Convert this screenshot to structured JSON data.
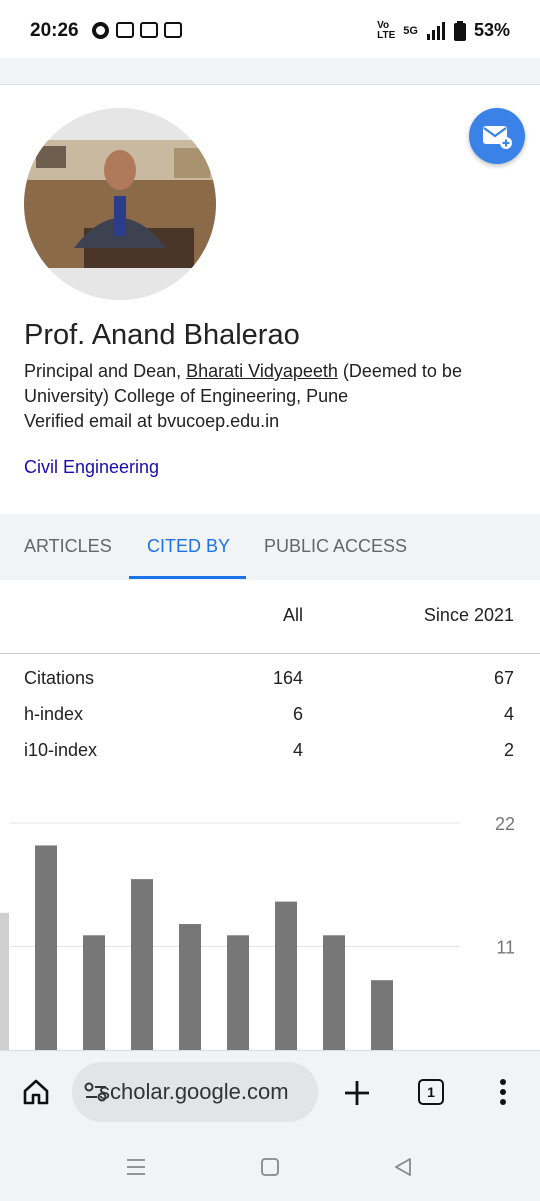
{
  "status": {
    "time": "20:26",
    "network": "5G",
    "battery": "53%"
  },
  "profile": {
    "name": "Prof. Anand Bhalerao",
    "affiliation_prefix": "Principal and Dean, ",
    "affiliation_link": "Bharati Vidyapeeth",
    "affiliation_suffix": " (Deemed to be University) College of Engineering, Pune",
    "email": "Verified email at bvucoep.edu.in",
    "interest": "Civil Engineering"
  },
  "tabs": [
    "ARTICLES",
    "CITED BY",
    "PUBLIC ACCESS"
  ],
  "citations_table": {
    "headers": [
      "All",
      "Since 2021"
    ],
    "rows": [
      {
        "label": "Citations",
        "all": "164",
        "since": "67"
      },
      {
        "label": "h-index",
        "all": "6",
        "since": "4"
      },
      {
        "label": "i10-index",
        "all": "4",
        "since": "2"
      }
    ]
  },
  "chart_data": {
    "type": "bar",
    "values": [
      14,
      20,
      12,
      17,
      13,
      12,
      15,
      12,
      8,
      1
    ],
    "yticks": [
      "22",
      "11"
    ],
    "ylim": [
      0,
      22
    ],
    "color": "#777777"
  },
  "browser": {
    "url": "scholar.google.com",
    "tab_count": "1"
  },
  "colors": {
    "accent": "#1a73e8",
    "link": "#1a0dab",
    "fab": "#3b82e8"
  }
}
